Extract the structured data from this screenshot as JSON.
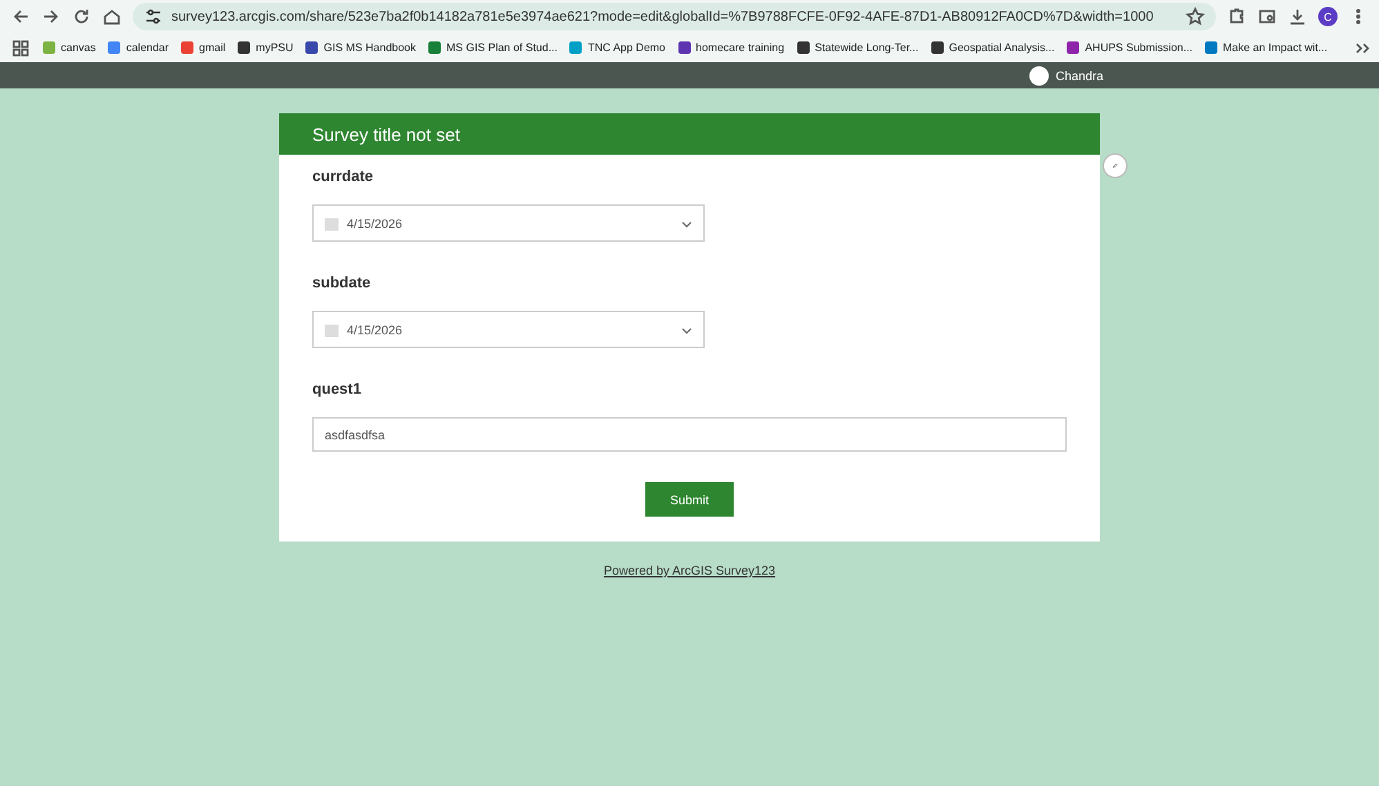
{
  "browser": {
    "url": "survey123.arcgis.com/share/523e7ba2f0b14182a781e5e3974ae621?mode=edit&globalId=%7B9788FCFE-0F92-4AFE-87D1-AB80912FA0CD%7D&width=1000",
    "profile_initial": "C",
    "bookmarks": [
      {
        "label": "canvas",
        "color": "#7cb342"
      },
      {
        "label": "calendar",
        "color": "#4285f4"
      },
      {
        "label": "gmail",
        "color": "#ea4335"
      },
      {
        "label": "myPSU",
        "color": "#333333"
      },
      {
        "label": "GIS MS Handbook",
        "color": "#3949ab"
      },
      {
        "label": "MS GIS Plan of Stud...",
        "color": "#188038"
      },
      {
        "label": "TNC App Demo",
        "color": "#00a0c6"
      },
      {
        "label": "homecare training",
        "color": "#5e35b1"
      },
      {
        "label": "Statewide Long-Ter...",
        "color": "#333333"
      },
      {
        "label": "Geospatial Analysis...",
        "color": "#333333"
      },
      {
        "label": "AHUPS Submission...",
        "color": "#8e24aa"
      },
      {
        "label": "Make an Impact wit...",
        "color": "#0079c1"
      }
    ]
  },
  "header": {
    "user": "Chandra"
  },
  "survey": {
    "title": "Survey title not set",
    "questions": [
      {
        "kind": "date",
        "label": "currdate",
        "value": "4/15/2026"
      },
      {
        "kind": "date",
        "label": "subdate",
        "value": "4/15/2026"
      },
      {
        "kind": "text",
        "label": "quest1",
        "value": "asdfasdfsa"
      }
    ],
    "submit": "Submit"
  },
  "footer": {
    "link": "Powered by ArcGIS Survey123"
  }
}
